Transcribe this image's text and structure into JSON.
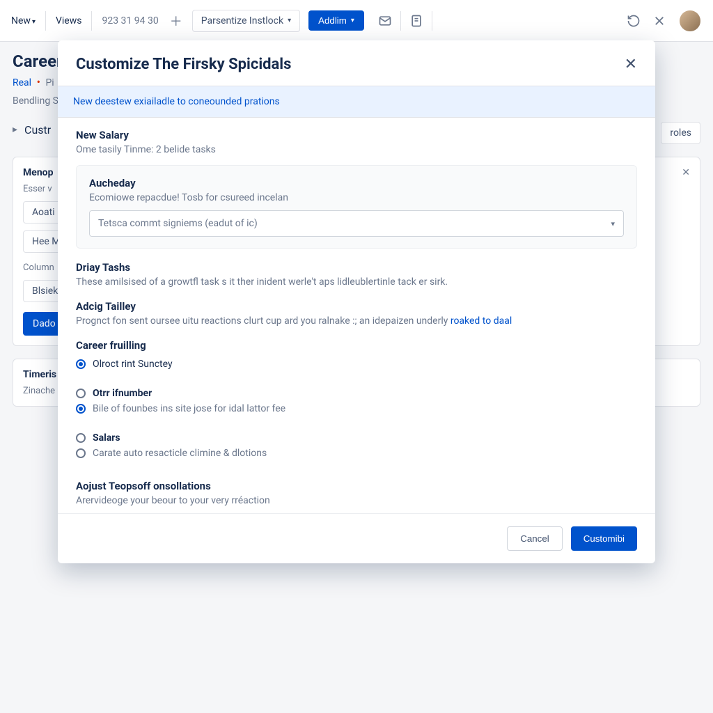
{
  "toolbar": {
    "new_label": "New",
    "views_label": "Views",
    "numbers": "923 31 94 30",
    "parsentize_label": "Parsentize Instlock",
    "addlim_label": "Addlim"
  },
  "page": {
    "title": "Career",
    "tab_real": "Real",
    "tab_pi": "Pi",
    "bending": "Bendling S",
    "cust_line": "Custr",
    "roles_label": "roles"
  },
  "card1": {
    "title": "Menop",
    "sub": "Esser v",
    "pill1": "Aoati",
    "pill2": "Hee M",
    "column_label": "Column",
    "pill3": "Blsiek",
    "primary": "Dado"
  },
  "card2": {
    "title": "Timeris",
    "sub": "Zinache"
  },
  "modal": {
    "title": "Customize The Firsky Spicidals",
    "banner": "New deestew exiailadle to coneounded prations",
    "salary_title": "New Salary",
    "salary_sub": "Ome tasily Tinme: 2 belide tasks",
    "aucheday_title": "Aucheday",
    "aucheday_sub": "Ecomiowe repacdue! Tosb for csureed incelan",
    "select_placeholder": "Tetsca commt signiems (eadut of ic)",
    "driay_title": "Driay Tashs",
    "driay_sub": "These amilsised of a growtfl task s it ther inident werle't aps lidleublertinle tack er sirk.",
    "adcig_title": "Adcig Tailley",
    "adcig_sub_pre": "Prognct fon sent oursee uitu reactions clurt cup ard you ralnake :; an idepaizen underly ",
    "adcig_link": "roaked to daal",
    "career_title": "Career fruilling",
    "radio1": "Olroct rint Sunctey",
    "radio2_title": "Otrr ifnumber",
    "radio2_sub": "Bile of founbes ins site jose for idal lattor fee",
    "radio3_title": "Salars",
    "radio3_sub": "Carate auto resacticle climine & dlotions",
    "adjust_title": "Aojust Teopsoff onsollations",
    "adjust_sub": "Arervideoge your beour to your very rréaction",
    "cancel": "Cancel",
    "confirm": "Customibi"
  }
}
